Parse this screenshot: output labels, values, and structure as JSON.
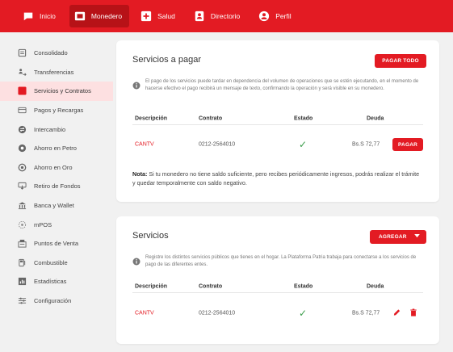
{
  "topnav": [
    {
      "label": "Inicio",
      "icon": "chat-icon",
      "active": false
    },
    {
      "label": "Monedero",
      "icon": "wallet-icon",
      "active": true
    },
    {
      "label": "Salud",
      "icon": "health-cross-icon",
      "active": false
    },
    {
      "label": "Directorio",
      "icon": "directory-icon",
      "active": false
    },
    {
      "label": "Perfil",
      "icon": "user-icon",
      "active": false
    }
  ],
  "sidebar": {
    "items": [
      {
        "label": "Consolidado",
        "icon": "consolidated-icon"
      },
      {
        "label": "Transferencias",
        "icon": "transfer-icon"
      },
      {
        "label": "Servicios y Contratos",
        "icon": "services-icon",
        "active": true
      },
      {
        "label": "Pagos y Recargas",
        "icon": "payments-icon"
      },
      {
        "label": "Intercambio",
        "icon": "exchange-icon"
      },
      {
        "label": "Ahorro en Petro",
        "icon": "petro-icon"
      },
      {
        "label": "Ahorro en Oro",
        "icon": "gold-icon"
      },
      {
        "label": "Retiro de Fondos",
        "icon": "withdraw-icon"
      },
      {
        "label": "Banca y Wallet",
        "icon": "bank-icon"
      },
      {
        "label": "mPOS",
        "icon": "mpos-icon"
      },
      {
        "label": "Puntos de Venta",
        "icon": "pos-icon"
      },
      {
        "label": "Combustible",
        "icon": "fuel-icon"
      },
      {
        "label": "Estadísticas",
        "icon": "stats-icon"
      },
      {
        "label": "Configuración",
        "icon": "settings-icon"
      }
    ]
  },
  "pay_card": {
    "title": "Servicios a pagar",
    "pay_all_label": "PAGAR TODO",
    "info": "El pago de los servicios puede tardar en dependencia del volumen de operaciones que se estén ejecutando, en el momento de hacerse efectivo el pago recibirá un mensaje de texto, confirmando la operación y será visible en su monedero.",
    "headers": {
      "desc": "Descripción",
      "contrato": "Contrato",
      "estado": "Estado",
      "deuda": "Deuda"
    },
    "row": {
      "desc": "CANTV",
      "contrato": "0212-2564010",
      "estado": "✓",
      "deuda": "Bs.S 72,77",
      "pay_label": "PAGAR"
    },
    "note_bold": "Nota:",
    "note": " Si tu monedero no tiene saldo suficiente, pero recibes periódicamente ingresos, podrás realizar el trámite y quedar temporalmente con saldo negativo."
  },
  "services_card": {
    "title": "Servicios",
    "add_label": "AGREGAR",
    "info": "Registre los distintos servicios públicos que tienes en el hogar. La Plataforma Patria trabaja para conectarse a los servicios de pago de las diferentes entes.",
    "headers": {
      "desc": "Descripción",
      "contrato": "Contrato",
      "estado": "Estado",
      "deuda": "Deuda"
    },
    "row": {
      "desc": "CANTV",
      "contrato": "0212-2564010",
      "estado": "✓",
      "deuda": "Bs.S 72,77"
    }
  },
  "colors": {
    "accent": "#e31b23",
    "ok": "#3a9d4a"
  }
}
